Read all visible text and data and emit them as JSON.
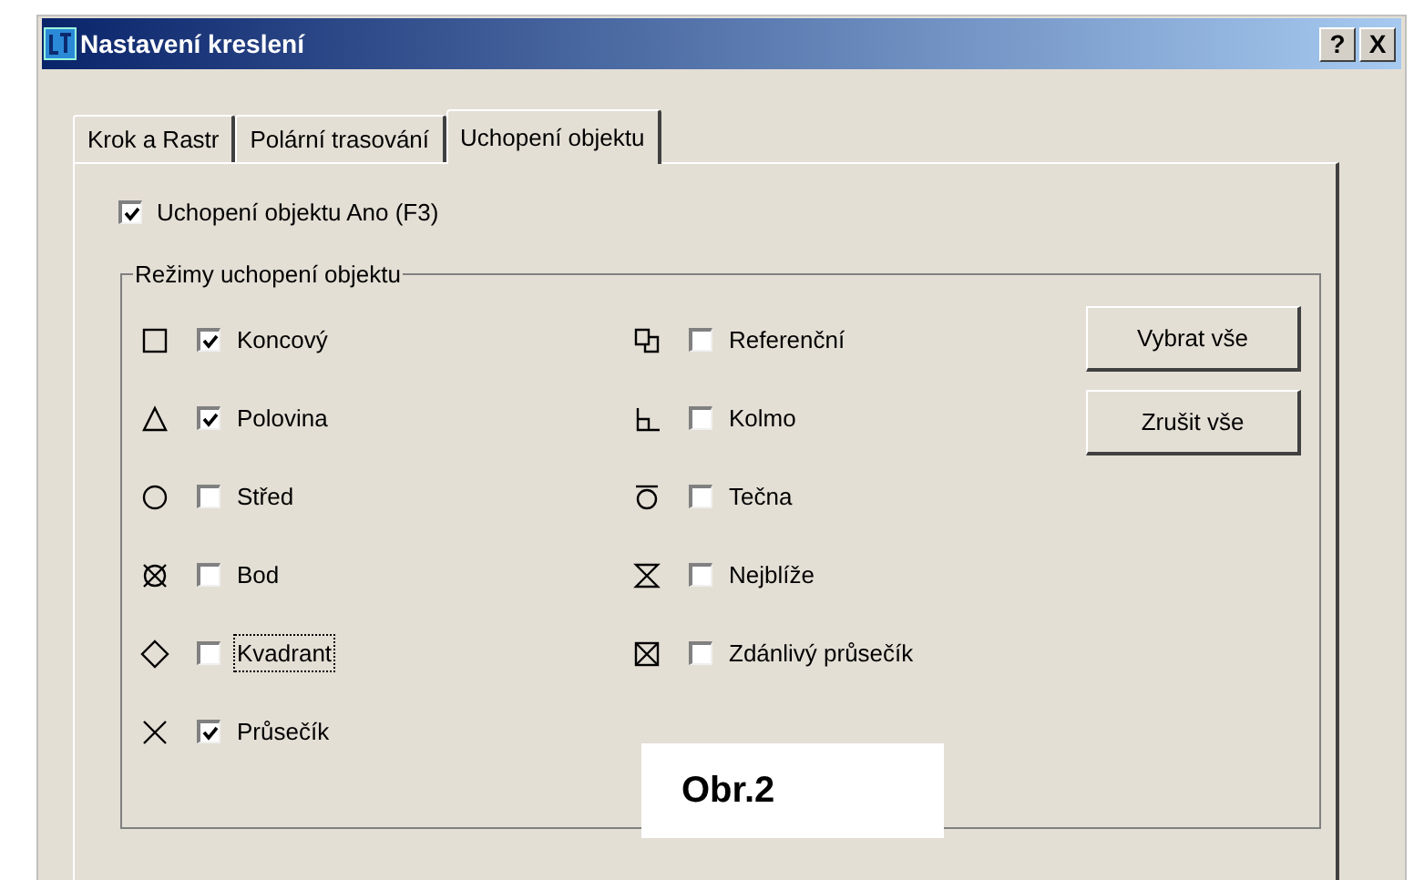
{
  "window": {
    "title": "Nastavení kreslení",
    "title_buttons": [
      "?",
      "X"
    ]
  },
  "tabs": [
    {
      "label": "Krok a Rastr",
      "selected": false
    },
    {
      "label": "Polární trasování",
      "selected": false
    },
    {
      "label": "Uchopení objektu",
      "selected": true
    }
  ],
  "snap_on": {
    "label": "Uchopení objektu Ano (F3)",
    "checked": true
  },
  "modes_group": {
    "title": "Režimy uchopení objektu",
    "left": [
      {
        "kind": "endpoint",
        "label": "Koncový",
        "checked": true,
        "focused": false
      },
      {
        "kind": "midpoint",
        "label": "Polovina",
        "checked": true,
        "focused": false
      },
      {
        "kind": "center",
        "label": "Střed",
        "checked": false,
        "focused": false
      },
      {
        "kind": "node",
        "label": "Bod",
        "checked": false,
        "focused": false
      },
      {
        "kind": "quadrant",
        "label": "Kvadrant",
        "checked": false,
        "focused": true
      },
      {
        "kind": "intersection",
        "label": "Průsečík",
        "checked": true,
        "focused": false
      }
    ],
    "right": [
      {
        "kind": "insertion",
        "label": "Referenční",
        "checked": false,
        "focused": false
      },
      {
        "kind": "perpendicular",
        "label": "Kolmo",
        "checked": false,
        "focused": false
      },
      {
        "kind": "tangent",
        "label": "Tečna",
        "checked": false,
        "focused": false
      },
      {
        "kind": "nearest",
        "label": "Nejblíže",
        "checked": false,
        "focused": false
      },
      {
        "kind": "apparent",
        "label": "Zdánlivý průsečík",
        "checked": false,
        "focused": false
      }
    ],
    "buttons": [
      "Vybrat vše",
      "Zrušit vše"
    ]
  },
  "caption": "Obr.2"
}
